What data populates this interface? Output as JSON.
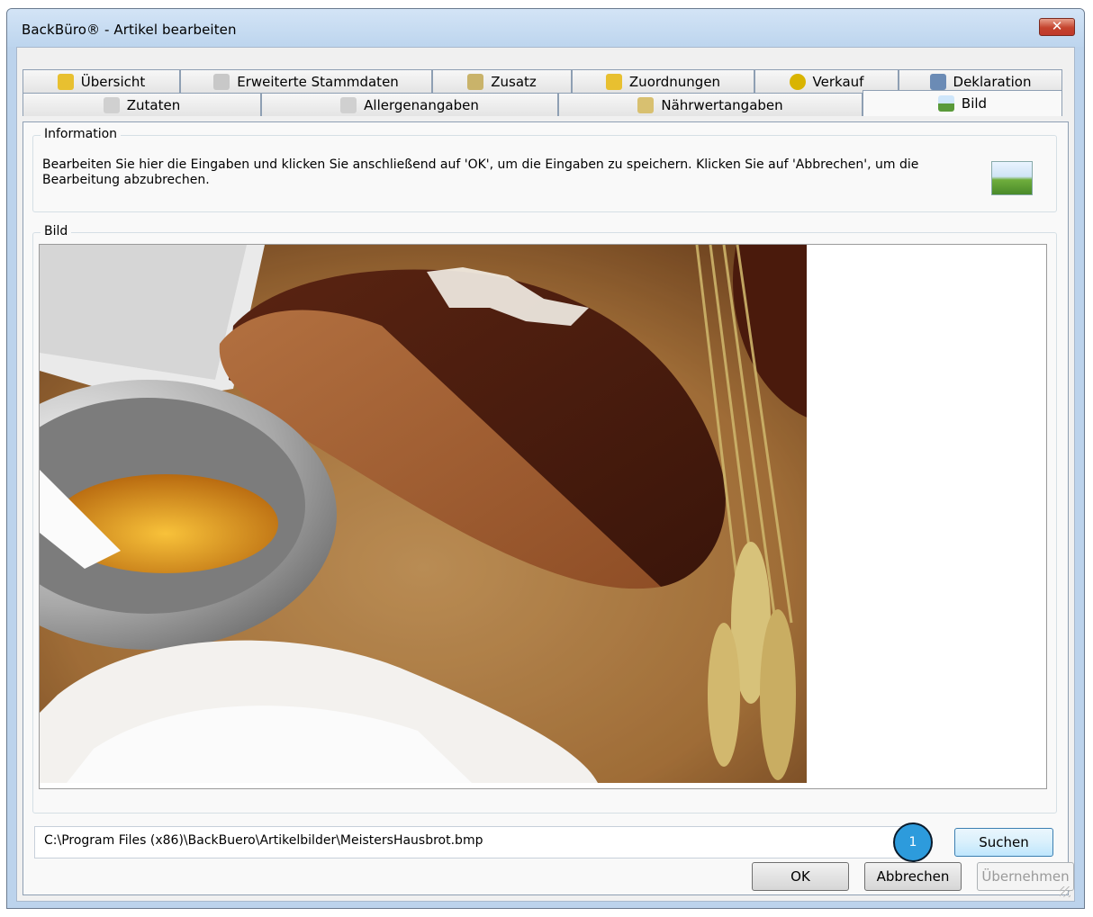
{
  "window": {
    "title": "BackBüro® - Artikel bearbeiten",
    "close_label": "✕"
  },
  "tabs_row1": [
    {
      "label": "Übersicht",
      "icon": "folder-icon",
      "color": "#e8c030"
    },
    {
      "label": "Erweiterte Stammdaten",
      "icon": "printer-icon",
      "color": "#c8c8c8"
    },
    {
      "label": "Zusatz",
      "icon": "tools-icon",
      "color": "#c9b36a"
    },
    {
      "label": "Zuordnungen",
      "icon": "folder-icon",
      "color": "#e8c030"
    },
    {
      "label": "Verkauf",
      "icon": "coins-icon",
      "color": "#d9b400"
    },
    {
      "label": "Deklaration",
      "icon": "list-icon",
      "color": "#6b8bb5"
    }
  ],
  "tabs_row2": [
    {
      "label": "Zutaten",
      "icon": "document-icon",
      "color": "#d0d0d0"
    },
    {
      "label": "Allergenangaben",
      "icon": "document-warning-icon",
      "color": "#d0d0d0"
    },
    {
      "label": "Nährwertangaben",
      "icon": "jar-icon",
      "color": "#d8c070"
    },
    {
      "label": "Bild",
      "icon": "picture-icon",
      "color": "#5a9a3a"
    }
  ],
  "info": {
    "legend": "Information",
    "text": "Bearbeiten Sie hier die Eingaben und klicken Sie anschließend auf 'OK', um die Eingaben zu speichern. Klicken Sie auf 'Abbrechen', um die Bearbeitung abzubrechen."
  },
  "image_group": {
    "legend": "Bild"
  },
  "path": "C:\\Program Files (x86)\\BackBuero\\Artikelbilder\\MeistersHausbrot.bmp",
  "marker_label": "1",
  "buttons": {
    "search": "Suchen",
    "ok": "OK",
    "cancel": "Abbrechen",
    "apply": "Übernehmen"
  }
}
